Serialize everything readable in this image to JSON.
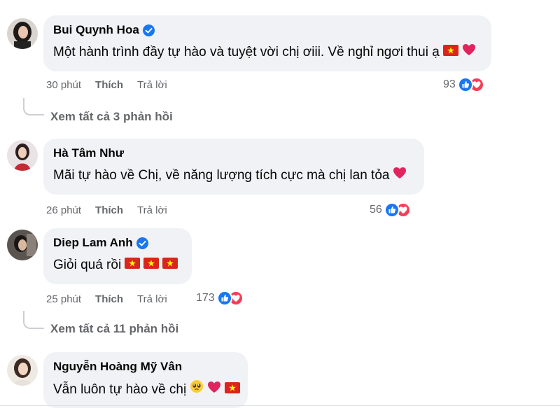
{
  "comments": [
    {
      "name": "Bui Quynh Hoa",
      "verified": true,
      "text": "Một hành trình đầy tự hào và tuyệt vời chị ơiii. Về nghỉ ngơi thui ạ",
      "time": "30 phút",
      "like_label": "Thích",
      "reply_label": "Trả lời",
      "reaction_count": "93",
      "view_replies": "Xem tất cả 3 phản hồi"
    },
    {
      "name": "Hà Tâm Như",
      "verified": false,
      "text": "Mãi tự hào về Chị, về năng lượng tích cực mà chị lan tỏa",
      "time": "26 phút",
      "like_label": "Thích",
      "reply_label": "Trả lời",
      "reaction_count": "56"
    },
    {
      "name": "Diep Lam Anh",
      "verified": true,
      "text": "Giỏi quá rồi",
      "time": "25 phút",
      "like_label": "Thích",
      "reply_label": "Trả lời",
      "reaction_count": "173",
      "view_replies": "Xem tất cả 11 phản hồi"
    },
    {
      "name": "Nguyễn Hoàng Mỹ Vân",
      "verified": false,
      "text": "Vẫn luôn tự hào về chị"
    }
  ],
  "colors": {
    "like_blue": "#1877f2",
    "love_red": "#f33e58",
    "bubble_bg": "#f0f2f5",
    "meta_gray": "#65676b",
    "flag_red": "#da251d",
    "flag_star": "#ffff00"
  }
}
